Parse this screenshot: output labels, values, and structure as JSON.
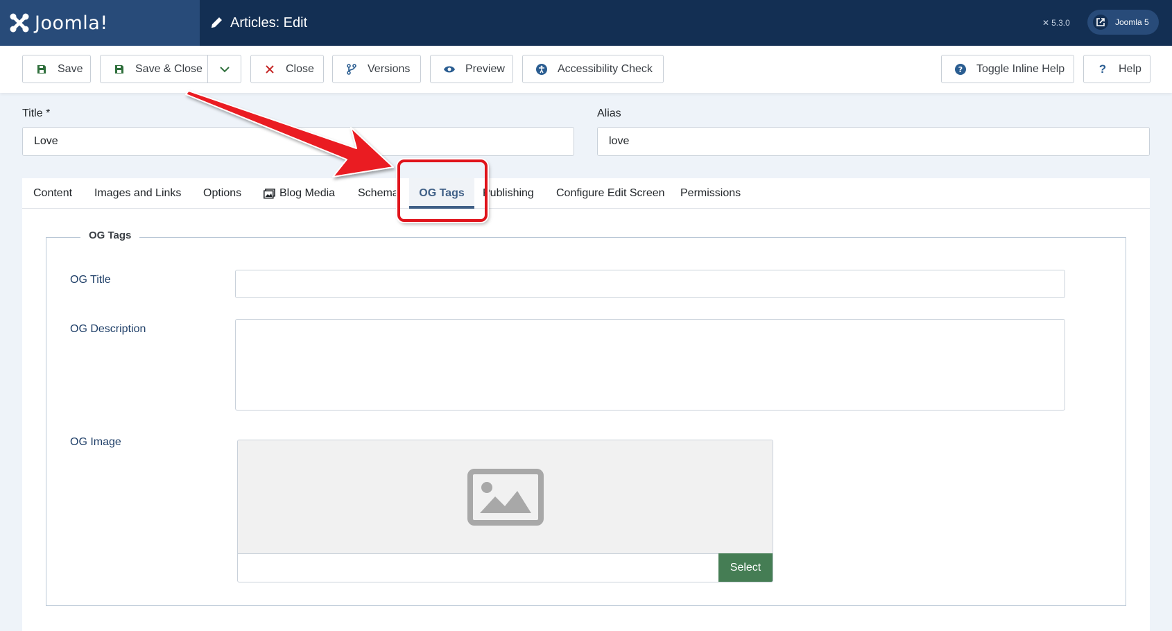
{
  "header": {
    "brand": "Joomla!",
    "page_title": "Articles: Edit",
    "version": "5.3.0",
    "site_button": "Joomla 5"
  },
  "toolbar": {
    "save": "Save",
    "save_close": "Save & Close",
    "close": "Close",
    "versions": "Versions",
    "preview": "Preview",
    "accessibility": "Accessibility Check",
    "toggle_help": "Toggle Inline Help",
    "help": "Help"
  },
  "form": {
    "title_label": "Title *",
    "title_value": "Love",
    "alias_label": "Alias",
    "alias_value": "love"
  },
  "tabs": [
    {
      "label": "Content"
    },
    {
      "label": "Images and Links"
    },
    {
      "label": "Options"
    },
    {
      "label": "Blog Media"
    },
    {
      "label": "Schema"
    },
    {
      "label": "OG Tags"
    },
    {
      "label": "Publishing"
    },
    {
      "label": "Configure Edit Screen"
    },
    {
      "label": "Permissions"
    }
  ],
  "og": {
    "legend": "OG Tags",
    "title_label": "OG Title",
    "title_value": "",
    "description_label": "OG Description",
    "description_value": "",
    "image_label": "OG Image",
    "image_value": "",
    "select_button": "Select"
  },
  "colors": {
    "header_bg": "#132f53",
    "brand_bg": "#284b79",
    "active_tab": "#3f5f86",
    "select_button": "#457d54",
    "annotation": "#e0131b"
  }
}
